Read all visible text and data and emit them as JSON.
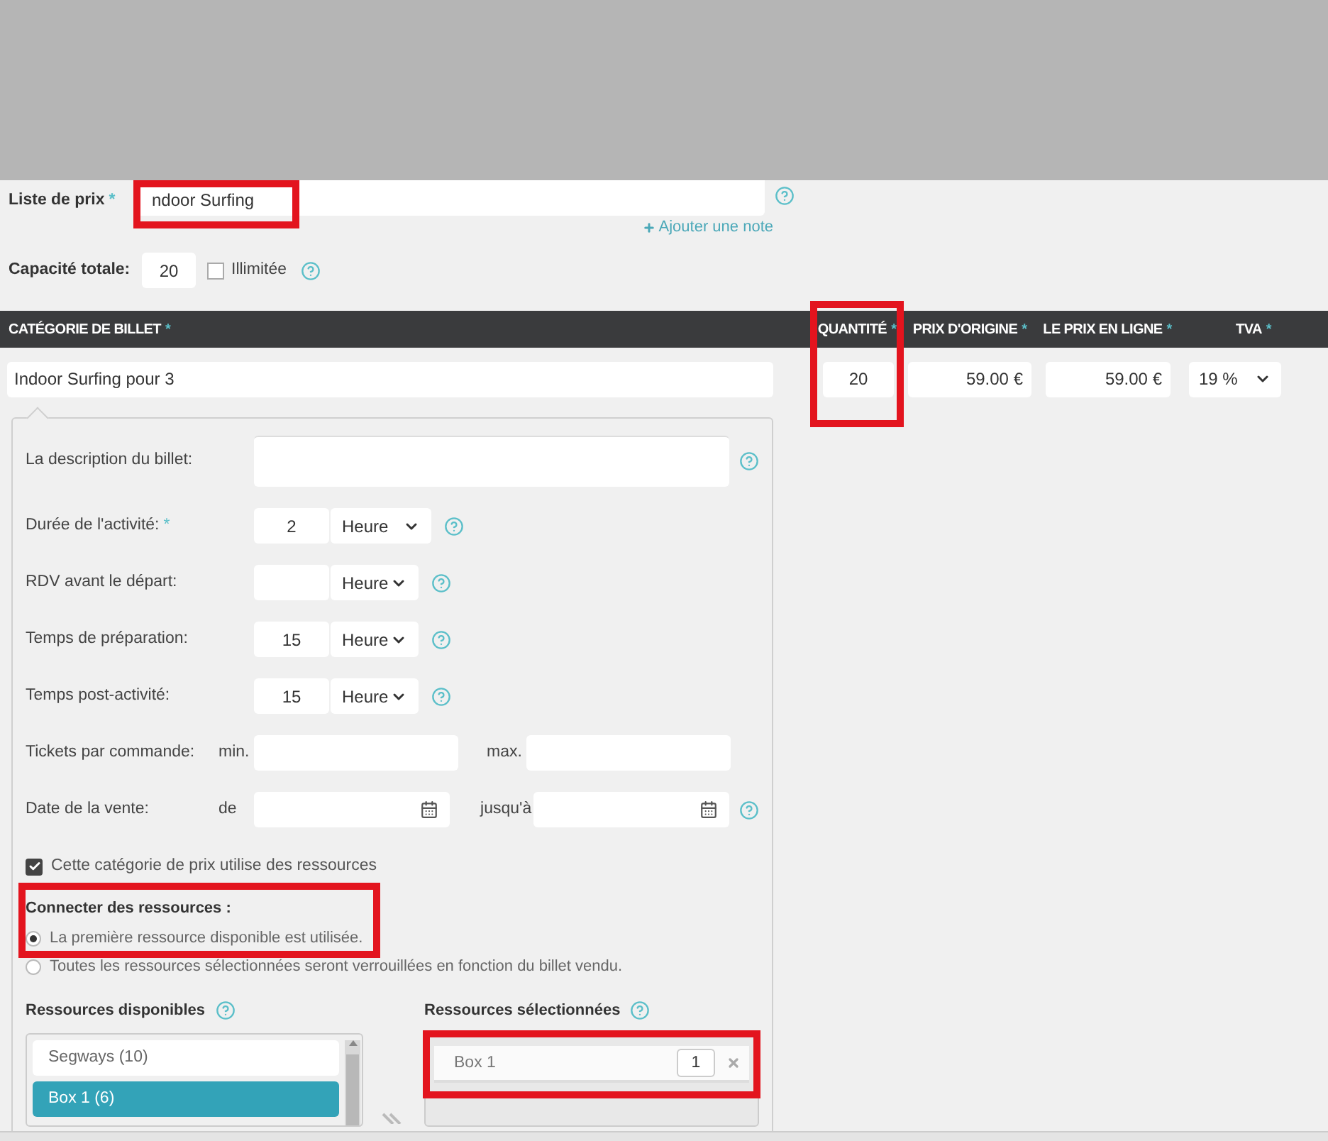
{
  "price_list": {
    "label": "Liste de prix",
    "required_mark": "*",
    "value": "ndoor Surfing",
    "highlighted": true,
    "note_link": "Ajouter une note"
  },
  "capacity": {
    "label": "Capacité totale:",
    "value": "20",
    "unlimited": {
      "label": "Illimitée",
      "checked": false
    }
  },
  "columns": [
    {
      "label": "CATÉGORIE DE BILLET",
      "required_mark": "*"
    },
    {
      "label": "QUANTITÉ",
      "required_mark": "*",
      "highlighted": true
    },
    {
      "label": "PRIX D'ORIGINE",
      "required_mark": "*"
    },
    {
      "label": "LE PRIX EN LIGNE",
      "required_mark": "*"
    },
    {
      "label": "TVA",
      "required_mark": "*"
    }
  ],
  "ticket": {
    "category": "Indoor Surfing pour 3",
    "quantity": "20",
    "original_price": "59.00 €",
    "online_price": "59.00 €",
    "vat": "19 %"
  },
  "fields": [
    {
      "kind": "textarea",
      "label": "La description du billet:"
    },
    {
      "kind": "number_unit",
      "label": "Durée de l'activité:",
      "required_mark": "*",
      "value": "2",
      "unit": "Heure"
    },
    {
      "kind": "number_unit",
      "label": "RDV avant le départ:",
      "unit": "Heure"
    },
    {
      "kind": "number_unit",
      "label": "Temps de préparation:",
      "value": "15",
      "unit": "Heure"
    },
    {
      "kind": "number_unit",
      "label": "Temps post-activité:",
      "value": "15",
      "unit": "Heure"
    },
    {
      "kind": "range",
      "label": "Tickets par commande:",
      "from_label": "min.",
      "to_label": "max."
    },
    {
      "kind": "date_range",
      "label": "Date de la vente:",
      "from_label": "de",
      "to_label": "jusqu'à"
    }
  ],
  "uses_resources": {
    "label": "Cette catégorie de prix utilise des ressources",
    "checked": true
  },
  "connect": {
    "title": "Connecter des ressources :",
    "highlighted": true,
    "options": [
      {
        "label": "La première ressource disponible est utilisée.",
        "selected": true
      },
      {
        "label": "Toutes les ressources sélectionnées seront verrouillées en fonction du billet vendu.",
        "selected": false
      }
    ]
  },
  "available": {
    "title": "Ressources disponibles",
    "items": [
      {
        "label": "Segways (10)",
        "selected": false
      },
      {
        "label": "Box 1 (6)",
        "selected": true
      }
    ]
  },
  "chosen": {
    "title": "Ressources sélectionnées",
    "items": [
      {
        "label": "Box 1",
        "quantity": "1",
        "highlighted": true
      }
    ]
  }
}
